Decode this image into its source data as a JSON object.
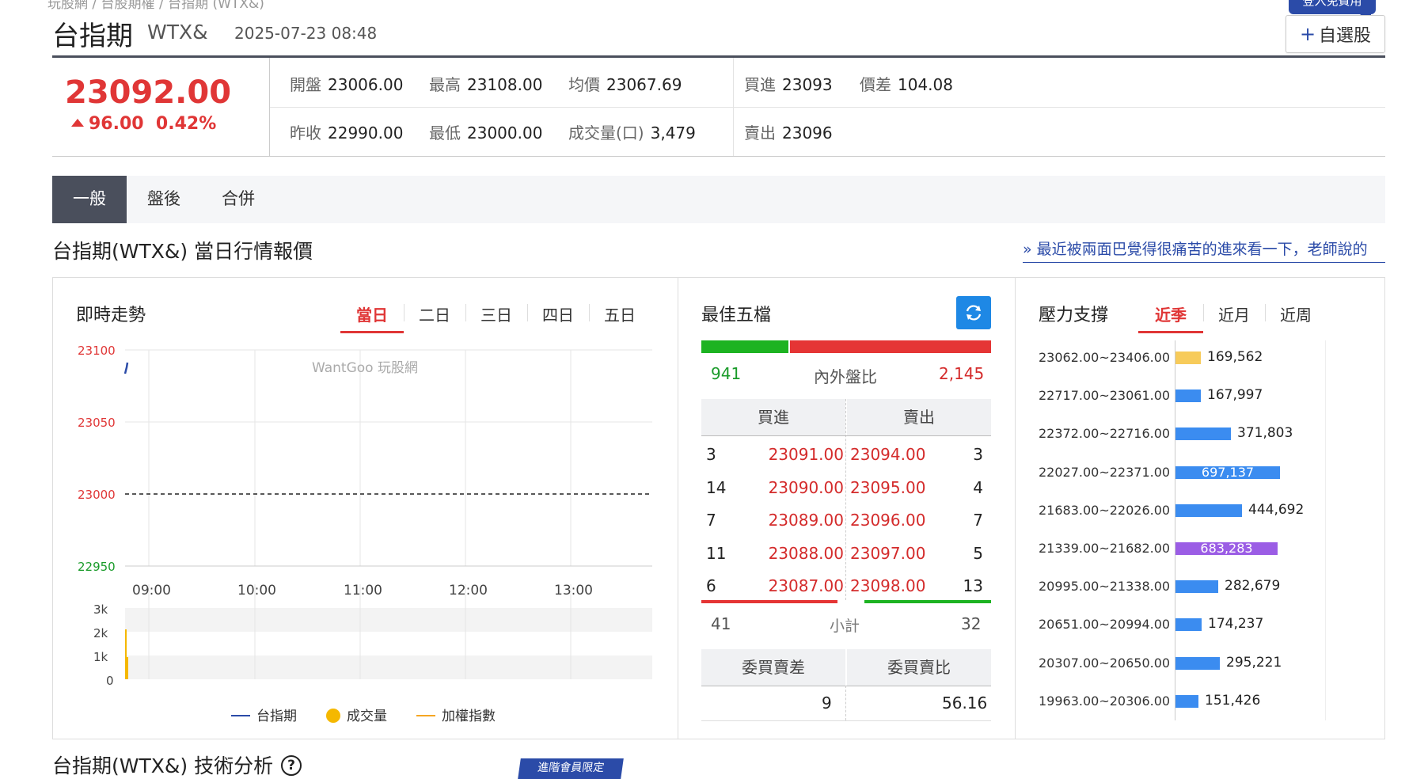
{
  "breadcrumb": [
    "玩股網",
    "台股期權",
    "台指期 (WTX&)"
  ],
  "header": {
    "title": "台指期",
    "code": "WTX&",
    "timestamp": "2025-07-23 08:48",
    "badge": "登入免費用",
    "watch_label": "自選股"
  },
  "quote": {
    "price": "23092.00",
    "change": "96.00",
    "change_pct": "0.42%",
    "stats_row1": [
      {
        "label": "開盤",
        "value": "23006.00"
      },
      {
        "label": "最高",
        "value": "23108.00"
      },
      {
        "label": "均價",
        "value": "23067.69"
      },
      {
        "label": "買進",
        "value": "23093"
      },
      {
        "label": "價差",
        "value": "104.08"
      }
    ],
    "stats_row2": [
      {
        "label": "昨收",
        "value": "22990.00"
      },
      {
        "label": "最低",
        "value": "23000.00"
      },
      {
        "label": "成交量(口)",
        "value": "3,479"
      },
      {
        "label": "賣出",
        "value": "23096"
      }
    ]
  },
  "tabs": [
    "一般",
    "盤後",
    "合併"
  ],
  "section": {
    "title": "台指期(WTX&) 當日行情報價",
    "news": "» 最近被兩面巴覺得很痛苦的進來看一下，老師說的"
  },
  "intraday": {
    "title": "即時走勢",
    "periods": [
      "當日",
      "二日",
      "三日",
      "四日",
      "五日"
    ],
    "watermark": "WantGoo 玩股網",
    "y_labels": [
      "23100",
      "23050",
      "23000",
      "22950"
    ],
    "x_labels": [
      "09:00",
      "10:00",
      "11:00",
      "12:00",
      "13:00"
    ],
    "vol_labels": [
      "3k",
      "2k",
      "1k",
      "0"
    ],
    "legend": [
      "台指期",
      "成交量",
      "加權指數"
    ]
  },
  "orderbook": {
    "title": "最佳五檔",
    "inner": "941",
    "ratio_label": "內外盤比",
    "outer": "2,145",
    "inner_frac": 0.305,
    "bid_header": "買進",
    "ask_header": "賣出",
    "rows": [
      {
        "bid_qty": "3",
        "bid": "23091.00",
        "ask": "23094.00",
        "ask_qty": "3"
      },
      {
        "bid_qty": "14",
        "bid": "23090.00",
        "ask": "23095.00",
        "ask_qty": "4"
      },
      {
        "bid_qty": "7",
        "bid": "23089.00",
        "ask": "23096.00",
        "ask_qty": "7"
      },
      {
        "bid_qty": "11",
        "bid": "23088.00",
        "ask": "23097.00",
        "ask_qty": "5"
      },
      {
        "bid_qty": "6",
        "bid": "23087.00",
        "ask": "23098.00",
        "ask_qty": "13"
      }
    ],
    "subtotal_bid": "41",
    "subtotal_label": "小計",
    "subtotal_ask": "32",
    "diff_label": "委買賣差",
    "ratio2_label": "委買賣比",
    "diff_value": "9",
    "ratio2_value": "56.16"
  },
  "support": {
    "title": "壓力支撐",
    "periods": [
      "近季",
      "近月",
      "近周"
    ],
    "rows": [
      {
        "range": "23062.00~23406.00",
        "value": "169,562",
        "v": 169562,
        "color": "#f7cb5a"
      },
      {
        "range": "22717.00~23061.00",
        "value": "167,997",
        "v": 167997,
        "color": "#3b8cf0"
      },
      {
        "range": "22372.00~22716.00",
        "value": "371,803",
        "v": 371803,
        "color": "#3b8cf0"
      },
      {
        "range": "22027.00~22371.00",
        "value": "697,137",
        "v": 697137,
        "color": "#3b8cf0"
      },
      {
        "range": "21683.00~22026.00",
        "value": "444,692",
        "v": 444692,
        "color": "#3b8cf0"
      },
      {
        "range": "21339.00~21682.00",
        "value": "683,283",
        "v": 683283,
        "color": "#9b5de5"
      },
      {
        "range": "20995.00~21338.00",
        "value": "282,679",
        "v": 282679,
        "color": "#3b8cf0"
      },
      {
        "range": "20651.00~20994.00",
        "value": "174,237",
        "v": 174237,
        "color": "#3b8cf0"
      },
      {
        "range": "20307.00~20650.00",
        "value": "295,221",
        "v": 295221,
        "color": "#3b8cf0"
      },
      {
        "range": "19963.00~20306.00",
        "value": "151,426",
        "v": 151426,
        "color": "#3b8cf0"
      }
    ]
  },
  "tech": {
    "title": "台指期(WTX&) 技術分析",
    "vip_badge": "進階會員限定"
  }
}
